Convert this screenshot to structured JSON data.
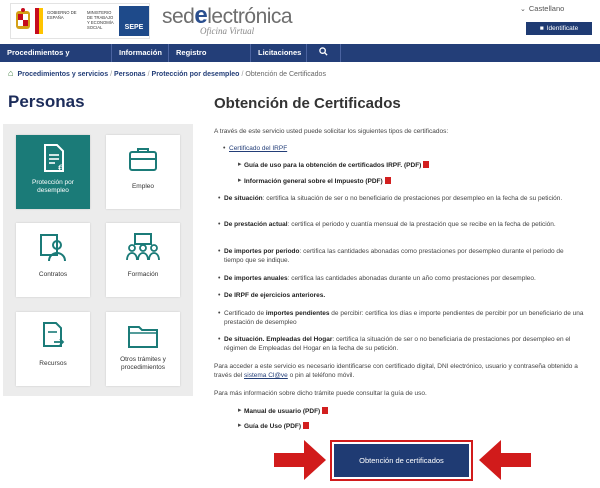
{
  "header": {
    "gov_text": "GOBIERNO DE ESPAÑA",
    "ministry_text": "MINISTERIO DE TRABAJO Y ECONOMÍA SOCIAL",
    "agency": "SEPE",
    "brand_left": "sed",
    "brand_e": "e",
    "brand_right": "lectrónica",
    "brand_sub": "Oficina Virtual",
    "language": "Castellano",
    "login": "Identificate"
  },
  "nav": {
    "items": [
      "Procedimientos y servicios",
      "Información",
      "Registro electrónico",
      "Licitaciones"
    ]
  },
  "breadcrumb": {
    "items": [
      "Procedimientos y servicios",
      "Personas",
      "Protección por desempleo"
    ],
    "current": "Obtención de Certificados"
  },
  "left": {
    "title": "Personas",
    "tiles": [
      {
        "label": "Protección por desempleo",
        "icon": "document-euro-icon"
      },
      {
        "label": "Empleo",
        "icon": "briefcase-icon"
      },
      {
        "label": "Contratos",
        "icon": "person-id-icon"
      },
      {
        "label": "Formación",
        "icon": "classroom-icon"
      },
      {
        "label": "Recursos",
        "icon": "document-arrow-icon"
      },
      {
        "label": "Otros trámites y procedimientos",
        "icon": "folder-icon"
      }
    ]
  },
  "main": {
    "title": "Obtención de Certificados",
    "intro": "A través de este servicio usted puede solicitar los siguientes tipos de certificados:",
    "irpf_link": "Certificado del IRPF",
    "irpf_sub1": "Guía de uso para la obtención de certificados IRPF. (PDF)",
    "irpf_sub2": "Información general sobre el Impuesto (PDF)",
    "items": [
      {
        "head": "De situación",
        "text": ": certifica la situación de ser o no beneficiario de prestaciones por desempleo en la fecha de su petición."
      },
      {
        "head": "De prestación actual",
        "text": ": certifica el periodo y cuantía mensual de la prestación que se recibe en la fecha de petición."
      },
      {
        "head": "De importes por periodo",
        "text": ": certifica las cantidades abonadas como prestaciones por desempleo durante el periodo de tiempo que se indique."
      },
      {
        "head": "De importes anuales",
        "text": ": certifica las cantidades abonadas durante un año como prestaciones por desempleo."
      },
      {
        "head": "De IRPF de ejercicios anteriores.",
        "text": ""
      },
      {
        "head": "",
        "pre": "Certificado de ",
        "head2": "importes pendientes",
        "text": " de percibir: certifica los días e importe pendientes de percibir por un beneficiario de una prestación de desempleo"
      },
      {
        "head": "De situación. Empleadas del Hogar",
        "text": ": certifica la situación de ser o no beneficiaria de prestaciones por desempleo en el régimen de Empleadas del Hogar en la fecha de su petición."
      }
    ],
    "access_text_1": "Para acceder a este servicio es necesario identificarse con certificado digital, DNI electrónico, usuario y contraseña obtenido a través del ",
    "access_link": "sistema Cl@ve",
    "access_text_2": " o pin al teléfono móvil.",
    "guide_text": "Para más información sobre dicho trámite puede consultar la guía de uso.",
    "manual_link": "Manual de usuario (PDF)",
    "guide_link": "Guía de Uso (PDF)",
    "cta": "Obtención de certificados"
  },
  "colors": {
    "navy": "#233e78",
    "teal": "#1b7b78",
    "red": "#d11b1b"
  }
}
